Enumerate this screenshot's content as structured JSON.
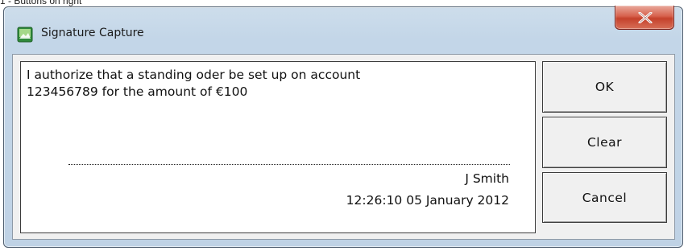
{
  "page_caption": "1 - Buttons on right",
  "window": {
    "title": "Signature Capture",
    "icon": "signature-app-icon",
    "close_icon": "close-icon",
    "accent_color": "#c4412b"
  },
  "signature_panel": {
    "text_line_1": "I authorize that a standing oder be set up on account",
    "text_line_2": "123456789 for the  amount of €100",
    "signer_name": "J Smith",
    "signed_at": "12:26:10 05 January 2012"
  },
  "buttons": {
    "ok_label": "OK",
    "clear_label": "Clear",
    "cancel_label": "Cancel"
  }
}
